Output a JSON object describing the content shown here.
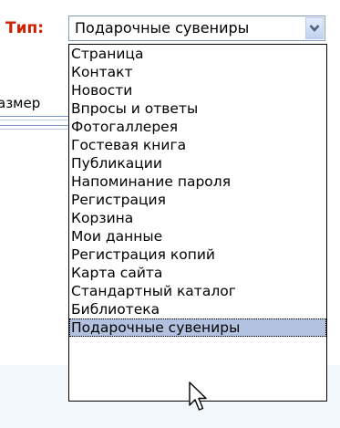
{
  "form": {
    "type_label": "Тип:",
    "select_value": "Подарочные сувениры",
    "arrow_icon": "chevron-down-icon",
    "background_label": "азмер"
  },
  "dropdown": {
    "options": [
      "Страница",
      "Контакт",
      "Новости",
      "Впросы и ответы",
      "Фотогаллерея",
      "Гостевая книга",
      "Публикации",
      "Напоминание пароля",
      "Регистрация",
      "Корзина",
      "Мои данные",
      "Регистрация копий",
      "Карта сайта",
      "Стандартный каталог",
      "Библиотека",
      "Подарочные сувениры"
    ],
    "selected": "Подарочные сувениры"
  },
  "colors": {
    "label": "#cc2200",
    "select_border": "#7f9db9",
    "highlight": "#b3c1e0"
  },
  "cursor_icon": "mouse-pointer-icon"
}
